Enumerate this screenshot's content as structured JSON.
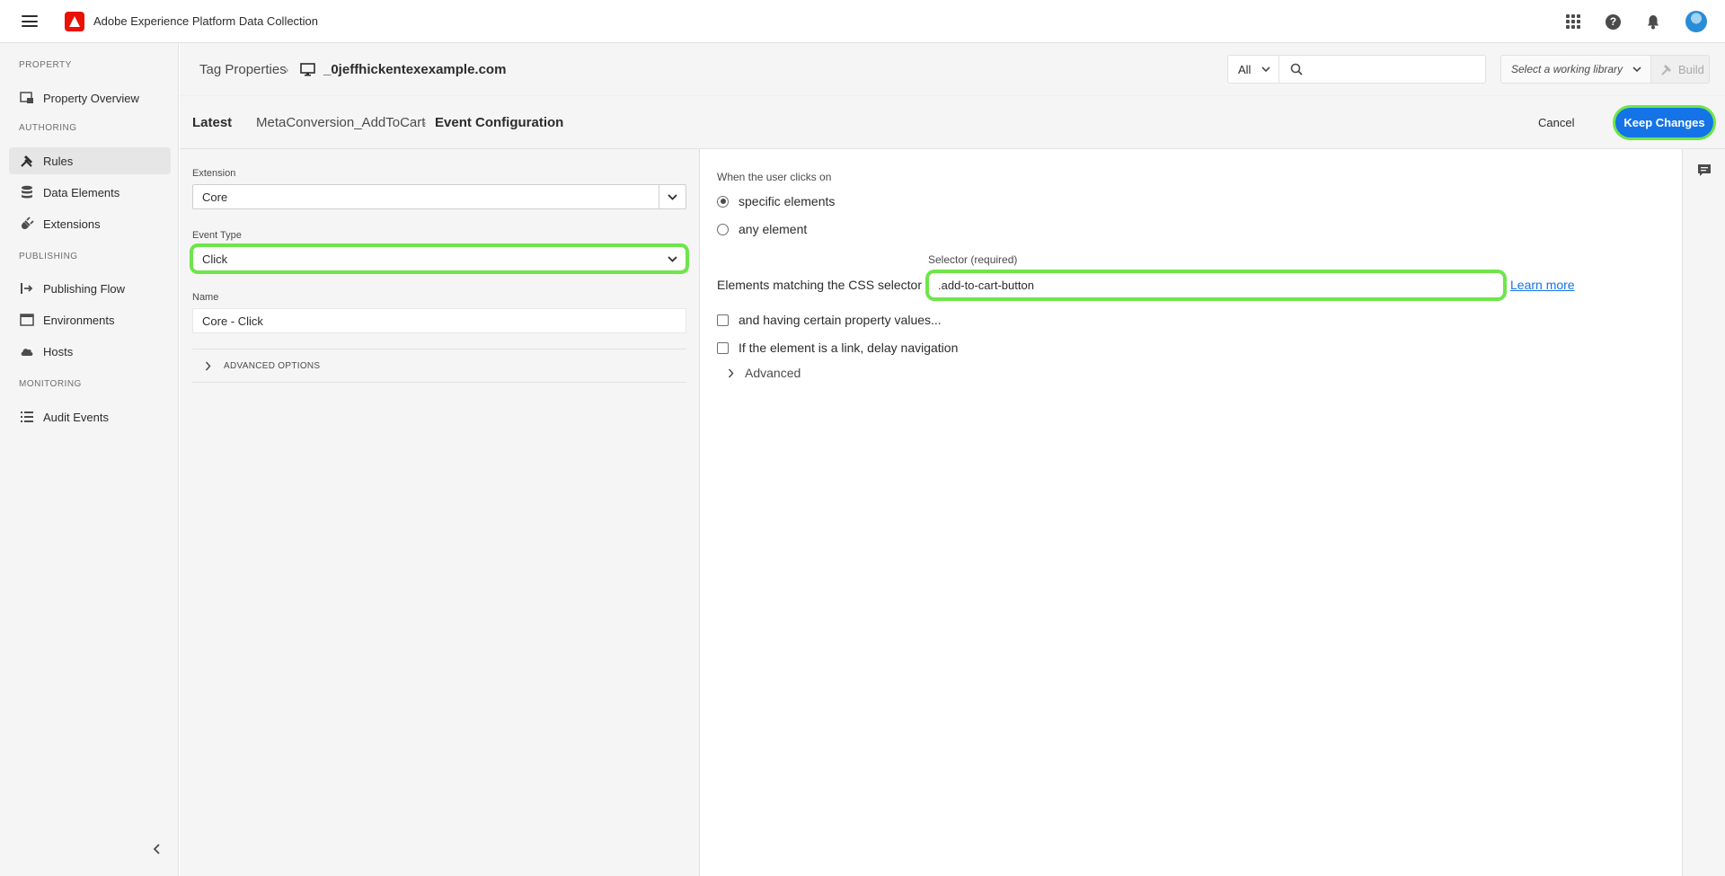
{
  "app": {
    "title": "Adobe Experience Platform Data Collection"
  },
  "topbar": {
    "icons": [
      "hamburger-icon",
      "adobe-logo",
      "apps-grid-icon",
      "help-icon",
      "bell-icon",
      "avatar"
    ],
    "help_glyph": "?"
  },
  "sidebar": {
    "sections": [
      {
        "label": "PROPERTY"
      },
      {
        "label": "AUTHORING"
      },
      {
        "label": "PUBLISHING"
      },
      {
        "label": "MONITORING"
      }
    ],
    "items": [
      {
        "label": "Property Overview",
        "icon": "property-overview-icon"
      },
      {
        "label": "Rules",
        "icon": "rules-icon",
        "active": true
      },
      {
        "label": "Data Elements",
        "icon": "data-elements-icon"
      },
      {
        "label": "Extensions",
        "icon": "extensions-icon"
      },
      {
        "label": "Publishing Flow",
        "icon": "publishing-flow-icon"
      },
      {
        "label": "Environments",
        "icon": "environments-icon"
      },
      {
        "label": "Hosts",
        "icon": "cloud-icon"
      },
      {
        "label": "Audit Events",
        "icon": "list-icon"
      }
    ]
  },
  "breadcrumb": {
    "root": "Tag Properties",
    "property": "_0jeffhickentexexample.com",
    "separator": "›"
  },
  "search": {
    "filter_value": "All",
    "placeholder": ""
  },
  "library": {
    "placeholder": "Select a working library",
    "build_label": "Build"
  },
  "config_header": {
    "latest": "Latest",
    "rule_name": "MetaConversion_AddToCart",
    "separator": "›",
    "title": "Event Configuration",
    "cancel": "Cancel",
    "keep_changes": "Keep Changes"
  },
  "left_panel": {
    "extension_label": "Extension",
    "extension_value": "Core",
    "event_type_label": "Event Type",
    "event_type_value": "Click",
    "name_label": "Name",
    "name_value": "Core - Click",
    "advanced_options": "ADVANCED OPTIONS"
  },
  "right_panel": {
    "when_label": "When the user clicks on",
    "radio_specific": "specific elements",
    "radio_any": "any element",
    "selected_radio": "specific elements",
    "selector_caption": "Selector (required)",
    "css_label": "Elements matching the CSS selector",
    "selector_value": ".add-to-cart-button",
    "learn_more": "Learn more",
    "check_property_values": "and having certain property values...",
    "check_delay_navigation": "If the element is a link, delay navigation",
    "advanced": "Advanced"
  },
  "colors": {
    "accent": "#1473e6",
    "highlight": "#6ee54a",
    "logo": "#eb1000"
  }
}
